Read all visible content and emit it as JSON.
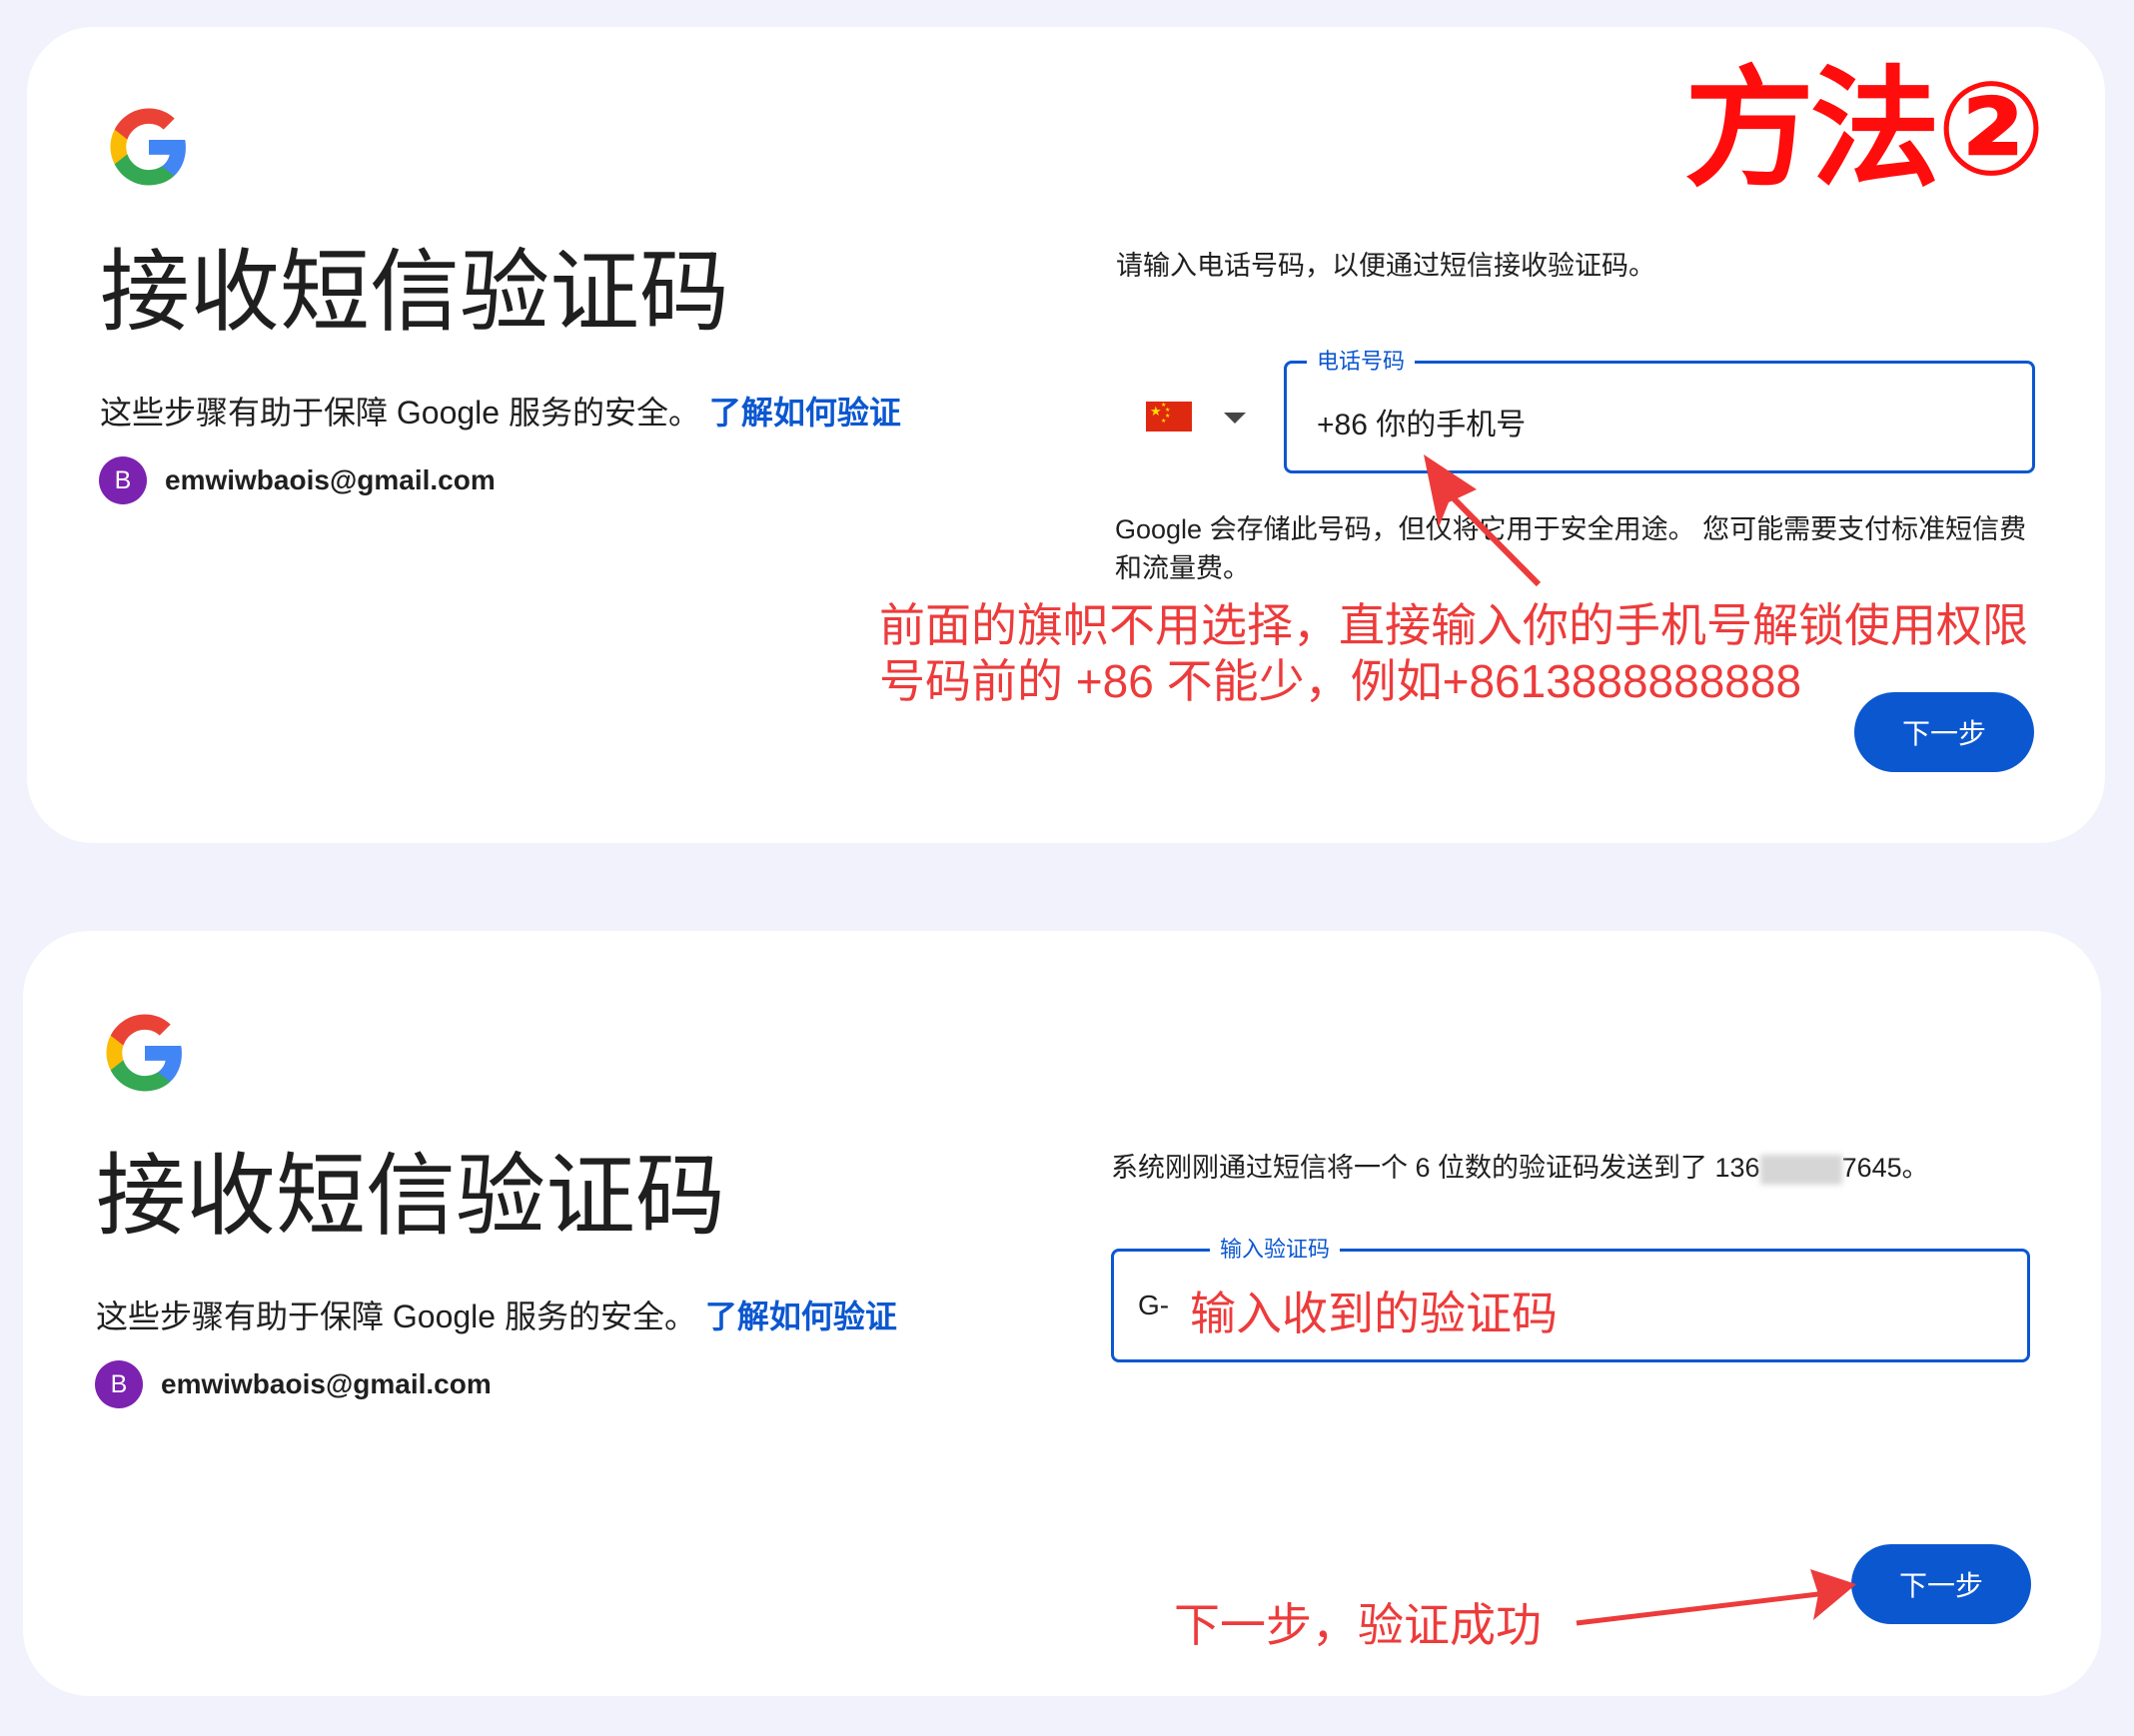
{
  "card_top": {
    "title": "接收短信验证码",
    "subtitle": "这些步骤有助于保障 Google 服务的安全。",
    "learn_link": "了解如何验证",
    "avatar_letter": "B",
    "email": "emwiwbaois@gmail.com",
    "instruction": "请输入电话号码，以便通过短信接收验证码。",
    "phone_field": {
      "label": "电话号码",
      "value": "+86 你的手机号",
      "country_flag": "china-flag"
    },
    "storage_notice": "Google 会存储此号码，但仅将它用于安全用途。 您可能需要支付标准短信费和流量费。",
    "next_button": "下一步"
  },
  "card_bottom": {
    "title": "接收短信验证码",
    "subtitle": "这些步骤有助于保障 Google 服务的安全。",
    "learn_link": "了解如何验证",
    "avatar_letter": "B",
    "email": "emwiwbaois@gmail.com",
    "instruction_prefix": "系统刚刚通过短信将一个 6 位数的验证码发送到了 136",
    "instruction_suffix": "7645。",
    "code_field": {
      "label": "输入验证码",
      "prefix": "G-",
      "value": "输入收到的验证码"
    },
    "next_button": "下一步"
  },
  "annotations": {
    "method_badge": "方法②",
    "flag_note_line1": "前面的旗帜不用选择，直接输入你的手机号解锁使用权限",
    "flag_note_line2": "号码前的 +86 不能少，例如+8613888888888",
    "success_note": "下一步，验证成功"
  },
  "colors": {
    "brand_blue": "#0b57d0",
    "annotation_red": "#ed3b3b",
    "avatar_purple": "#7b22b0",
    "page_bg": "#f1f2fb"
  },
  "icons": [
    "google-logo-icon",
    "china-flag-icon",
    "chevron-down-icon",
    "arrow-annotation-icon"
  ]
}
